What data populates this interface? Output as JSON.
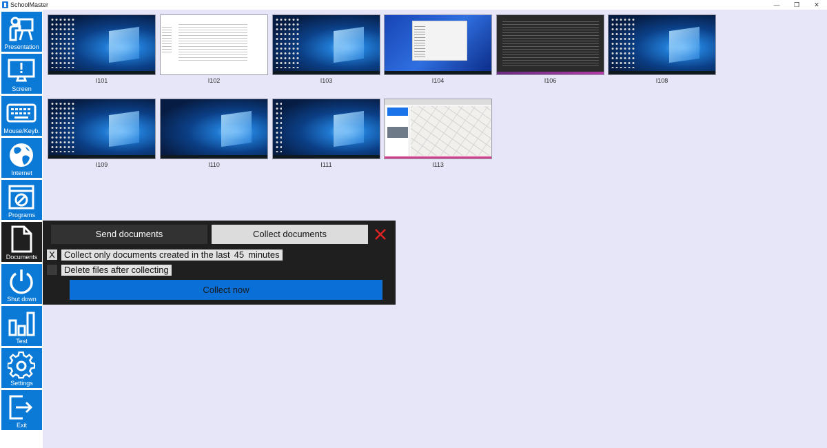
{
  "window": {
    "title": "SchoolMaster",
    "minimize": "—",
    "restore": "❐",
    "close": "✕"
  },
  "sidebar": {
    "items": [
      {
        "label": "Presentation",
        "icon": "presentation-icon"
      },
      {
        "label": "Screen",
        "icon": "screen-icon"
      },
      {
        "label": "Mouse/Keyb.",
        "icon": "keyboard-icon"
      },
      {
        "label": "Internet",
        "icon": "globe-icon"
      },
      {
        "label": "Programs",
        "icon": "programs-icon"
      },
      {
        "label": "Documents",
        "icon": "document-icon",
        "active": true
      },
      {
        "label": "Shut down",
        "icon": "power-icon"
      },
      {
        "label": "Test",
        "icon": "bar-chart-icon"
      },
      {
        "label": "Settings",
        "icon": "gear-icon"
      },
      {
        "label": "Exit",
        "icon": "exit-icon"
      }
    ]
  },
  "computers": [
    {
      "name": "I101",
      "screen": "desktop"
    },
    {
      "name": "I102",
      "screen": "document"
    },
    {
      "name": "I103",
      "screen": "desktop"
    },
    {
      "name": "I104",
      "screen": "file-explorer"
    },
    {
      "name": "I106",
      "screen": "code-editor"
    },
    {
      "name": "I108",
      "screen": "desktop"
    },
    {
      "name": "I109",
      "screen": "desktop"
    },
    {
      "name": "I110",
      "screen": "desktop"
    },
    {
      "name": "I111",
      "screen": "desktop"
    },
    {
      "name": "I113",
      "screen": "browser-map"
    }
  ],
  "documents_panel": {
    "send_tab": "Send documents",
    "collect_tab": "Collect documents",
    "active_tab": "collect",
    "close_icon": "close-icon",
    "close_color": "#e02020",
    "collect_only_checked": true,
    "collect_only_mark": "X",
    "collect_only_prefix": "Collect only documents created in the last",
    "collect_only_minutes": "45",
    "collect_only_suffix": "minutes",
    "delete_after_checked": false,
    "delete_after_label": "Delete files after collecting",
    "collect_now": "Collect now"
  },
  "colors": {
    "accent": "#0a7ad6",
    "background": "#e6e6f8",
    "panel": "#1f1f1f"
  }
}
